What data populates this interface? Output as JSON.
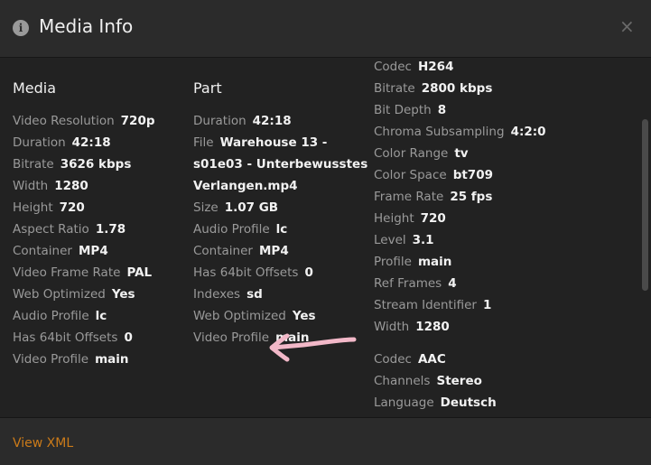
{
  "header": {
    "title": "Media Info",
    "info_icon": "info-icon",
    "close_label": "×"
  },
  "media": {
    "heading": "Media",
    "rows": [
      {
        "label": "Video Resolution",
        "value": "720p"
      },
      {
        "label": "Duration",
        "value": "42:18"
      },
      {
        "label": "Bitrate",
        "value": "3626 kbps"
      },
      {
        "label": "Width",
        "value": "1280"
      },
      {
        "label": "Height",
        "value": "720"
      },
      {
        "label": "Aspect Ratio",
        "value": "1.78"
      },
      {
        "label": "Container",
        "value": "MP4"
      },
      {
        "label": "Video Frame Rate",
        "value": "PAL"
      },
      {
        "label": "Web Optimized",
        "value": "Yes"
      },
      {
        "label": "Audio Profile",
        "value": "lc"
      },
      {
        "label": "Has 64bit Offsets",
        "value": "0"
      },
      {
        "label": "Video Profile",
        "value": "main"
      }
    ]
  },
  "part": {
    "heading": "Part",
    "rows": [
      {
        "label": "Duration",
        "value": "42:18"
      },
      {
        "label": "File",
        "value": "Warehouse 13 -",
        "line2": "s01e03 - Unterbewusstes",
        "line3": "Verlangen.mp4"
      },
      {
        "label": "Size",
        "value": "1.07 GB"
      },
      {
        "label": "Audio Profile",
        "value": "lc"
      },
      {
        "label": "Container",
        "value": "MP4"
      },
      {
        "label": "Has 64bit Offsets",
        "value": "0"
      },
      {
        "label": "Indexes",
        "value": "sd"
      },
      {
        "label": "Web Optimized",
        "value": "Yes"
      },
      {
        "label": "Video Profile",
        "value": "main"
      }
    ]
  },
  "video_stream": {
    "rows": [
      {
        "label": "Codec",
        "value": "H264"
      },
      {
        "label": "Bitrate",
        "value": "2800 kbps"
      },
      {
        "label": "Bit Depth",
        "value": "8"
      },
      {
        "label": "Chroma Subsampling",
        "value": "4:2:0"
      },
      {
        "label": "Color Range",
        "value": "tv"
      },
      {
        "label": "Color Space",
        "value": "bt709"
      },
      {
        "label": "Frame Rate",
        "value": "25 fps"
      },
      {
        "label": "Height",
        "value": "720"
      },
      {
        "label": "Level",
        "value": "3.1"
      },
      {
        "label": "Profile",
        "value": "main"
      },
      {
        "label": "Ref Frames",
        "value": "4"
      },
      {
        "label": "Stream Identifier",
        "value": "1"
      },
      {
        "label": "Width",
        "value": "1280"
      }
    ]
  },
  "audio_stream": {
    "rows": [
      {
        "label": "Codec",
        "value": "AAC"
      },
      {
        "label": "Channels",
        "value": "Stereo"
      },
      {
        "label": "Language",
        "value": "Deutsch"
      }
    ]
  },
  "footer": {
    "view_xml_label": "View XML"
  },
  "colors": {
    "accent": "#cc7b19",
    "annotation_arrow": "#f2b8c8"
  }
}
